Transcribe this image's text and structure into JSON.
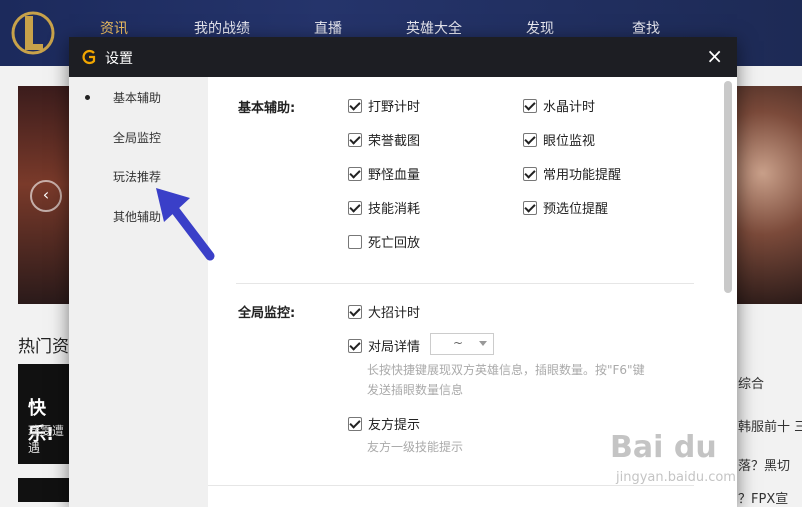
{
  "topnav": {
    "items": [
      "资讯",
      "我的战绩",
      "直播",
      "英雄大全",
      "发现",
      "查找"
    ]
  },
  "background": {
    "hot_heading": "热门资",
    "card_title": "快乐!",
    "card_sub": "瑞雯遭遇",
    "right_texts": [
      "综合",
      "韩服前十 三",
      "落？黑切",
      "？FPX宣"
    ]
  },
  "dialog": {
    "title": "设置",
    "close": "×",
    "sidebar": [
      "基本辅助",
      "全局监控",
      "玩法推荐",
      "其他辅助"
    ],
    "sections": {
      "basic": {
        "label": "基本辅助:",
        "options": [
          {
            "label": "打野计时",
            "checked": true
          },
          {
            "label": "水晶计时",
            "checked": true
          },
          {
            "label": "荣誉截图",
            "checked": true
          },
          {
            "label": "眼位监视",
            "checked": true
          },
          {
            "label": "野怪血量",
            "checked": true
          },
          {
            "label": "常用功能提醒",
            "checked": true
          },
          {
            "label": "技能消耗",
            "checked": true
          },
          {
            "label": "预选位提醒",
            "checked": true
          },
          {
            "label": "死亡回放",
            "checked": false
          }
        ]
      },
      "global": {
        "label": "全局监控:",
        "ult_timer": "大招计时",
        "match_detail": "对局详情",
        "select_value": "~",
        "match_hint_1": "长按快捷键展现双方英雄信息，插眼数量。按\"F6\"键",
        "match_hint_2": "发送插眼数量信息",
        "ally_tip": "友方提示",
        "ally_hint": "友方一级技能提示"
      }
    }
  },
  "watermark": {
    "line1": "Bai du",
    "line2": "jingyan.baidu.com"
  }
}
